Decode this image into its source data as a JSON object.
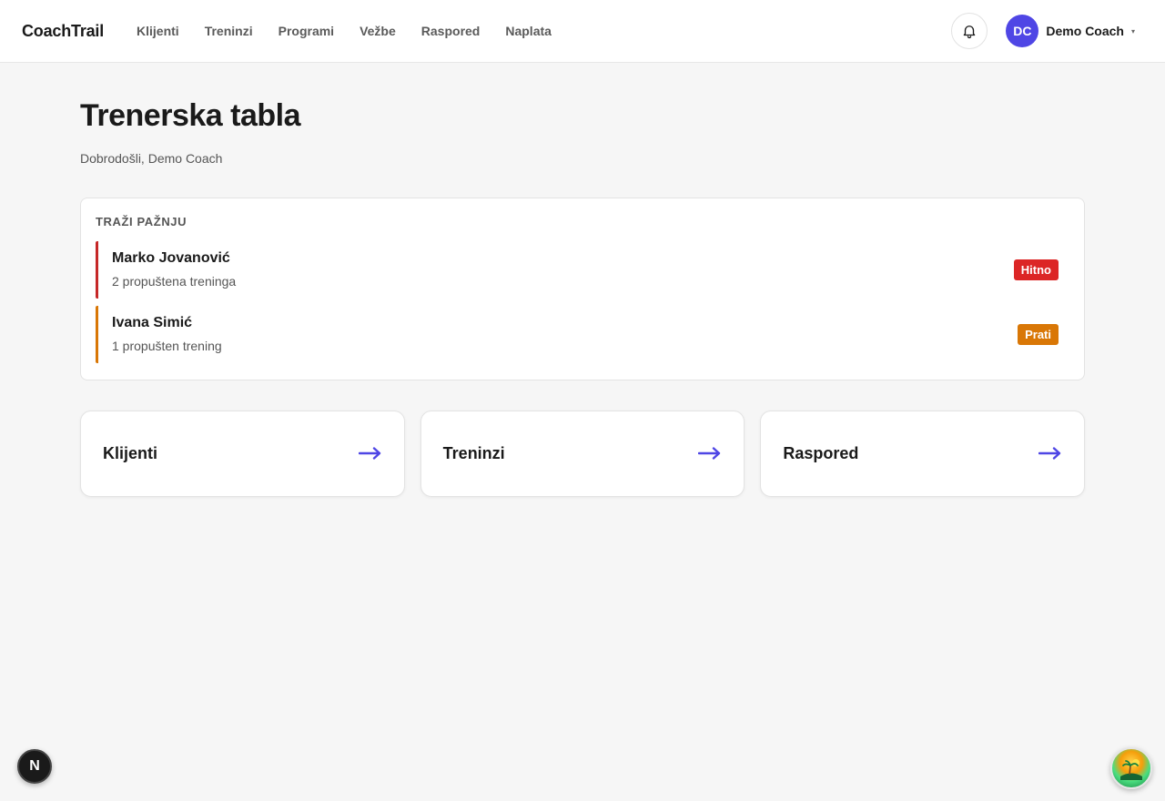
{
  "header": {
    "brand": "CoachTrail",
    "nav": [
      {
        "label": "Klijenti"
      },
      {
        "label": "Treninzi"
      },
      {
        "label": "Programi"
      },
      {
        "label": "Vežbe"
      },
      {
        "label": "Raspored"
      },
      {
        "label": "Naplata"
      }
    ],
    "bell_icon": "bell-icon",
    "user": {
      "initials": "DC",
      "name": "Demo Coach",
      "caret": "▾",
      "avatar_color": "#4f46e5"
    }
  },
  "main": {
    "title": "Trenerska tabla",
    "subtitle": "Dobrodošli, Demo Coach",
    "attention": {
      "title": "TRAŽI PAŽNJU",
      "items": [
        {
          "name": "Marko Jovanović",
          "detail": "2 propuštena treninga",
          "badge": "Hitno",
          "badge_color": "#dc2626",
          "accent_color": "#c62828"
        },
        {
          "name": "Ivana Simić",
          "detail": "1 propušten trening",
          "badge": "Prati",
          "badge_color": "#d97706",
          "accent_color": "#d97706"
        }
      ]
    },
    "quick_links": [
      {
        "label": "Klijenti",
        "icon": "arrow-right-icon"
      },
      {
        "label": "Treninzi",
        "icon": "arrow-right-icon"
      },
      {
        "label": "Raspored",
        "icon": "arrow-right-icon"
      }
    ]
  },
  "floating": {
    "next_badge": "N",
    "assistant_icon": "island-icon"
  },
  "colors": {
    "accent": "#4f46e5",
    "danger": "#dc2626",
    "warning": "#d97706"
  }
}
